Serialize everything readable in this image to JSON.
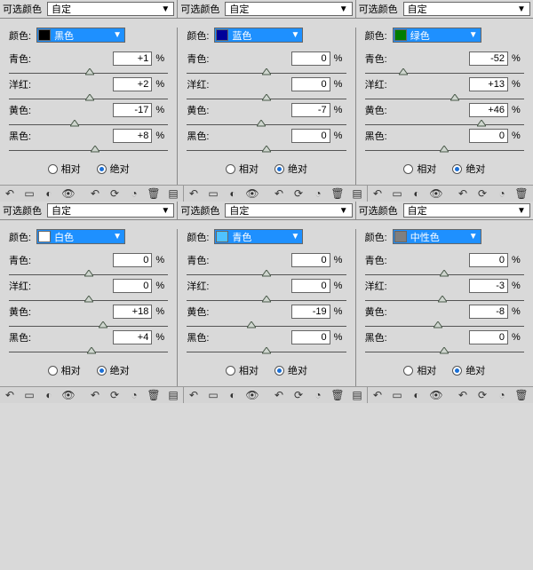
{
  "labels": {
    "selectable_color": "可选颜色",
    "preset": "自定",
    "color": "颜色:",
    "cyan": "青色:",
    "magenta": "洋红:",
    "yellow": "黄色:",
    "black": "黑色:",
    "pct": "%",
    "relative": "相对",
    "absolute": "绝对"
  },
  "panels": [
    {
      "swatch_bg": "#000000",
      "swatch_name": "黑色",
      "selBg": true,
      "vals": {
        "cyan": "+1",
        "magenta": "+2",
        "yellow": "-17",
        "black": "+8"
      },
      "pos": {
        "cyan": 50.5,
        "magenta": 51,
        "yellow": 41.5,
        "black": 54
      },
      "mode": "absolute"
    },
    {
      "swatch_bg": "#000099",
      "swatch_name": "蓝色",
      "selBg": true,
      "vals": {
        "cyan": "0",
        "magenta": "0",
        "yellow": "-7",
        "black": "0"
      },
      "pos": {
        "cyan": 50,
        "magenta": 50,
        "yellow": 46.5,
        "black": 50
      },
      "mode": "absolute"
    },
    {
      "swatch_bg": "#007d00",
      "swatch_name": "绿色",
      "selBg": true,
      "vals": {
        "cyan": "-52",
        "magenta": "+13",
        "yellow": "+46",
        "black": "0"
      },
      "pos": {
        "cyan": 24,
        "magenta": 56.5,
        "yellow": 73,
        "black": 50
      },
      "mode": "absolute"
    },
    {
      "swatch_bg": "#ffffff",
      "swatch_name": "白色",
      "selBg": true,
      "inv": true,
      "vals": {
        "cyan": "0",
        "magenta": "0",
        "yellow": "+18",
        "black": "+4"
      },
      "pos": {
        "cyan": 50,
        "magenta": 50,
        "yellow": 59,
        "black": 52
      },
      "mode": "absolute"
    },
    {
      "swatch_bg": "#4fc2ff",
      "swatch_name": "青色",
      "selBg": true,
      "altLabel": true,
      "vals": {
        "cyan": "0",
        "magenta": "0",
        "yellow": "-19",
        "black": "0"
      },
      "pos": {
        "cyan": 50,
        "magenta": 50,
        "yellow": 40.5,
        "black": 50
      },
      "mode": "absolute"
    },
    {
      "swatch_bg": "#7f7f7f",
      "swatch_name": "中性色",
      "selBg": true,
      "altLabel": true,
      "vals": {
        "cyan": "0",
        "magenta": "-3",
        "yellow": "-8",
        "black": "0"
      },
      "pos": {
        "cyan": 50,
        "magenta": 48.5,
        "yellow": 46,
        "black": 50
      },
      "mode": "absolute"
    }
  ]
}
